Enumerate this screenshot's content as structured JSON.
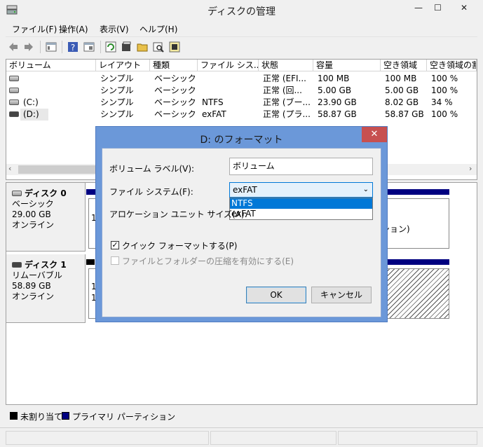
{
  "window": {
    "title": "ディスクの管理",
    "minimize_glyph": "—",
    "maximize_glyph": "☐",
    "close_glyph": "✕"
  },
  "menu": {
    "items": [
      "ファイル(F)",
      "操作(A)",
      "表示(V)",
      "ヘルプ(H)"
    ]
  },
  "toolbar": {
    "icons": [
      "back-arrow-icon",
      "forward-arrow-icon",
      "console-tree-icon",
      "help-icon",
      "properties-view-icon",
      "refresh-icon",
      "properties-icon",
      "open-folder-icon",
      "explore-icon",
      "settings-icon"
    ]
  },
  "volume_table": {
    "headers": [
      "ボリューム",
      "レイアウト",
      "種類",
      "ファイル シス...",
      "状態",
      "容量",
      "空き領域",
      "空き領域の割"
    ],
    "rows": [
      {
        "volume": "",
        "layout": "シンプル",
        "type": "ベーシック",
        "fs": "",
        "status": "正常 (EFI...",
        "capacity": "100 MB",
        "free": "100 MB",
        "pct": "100 %"
      },
      {
        "volume": "",
        "layout": "シンプル",
        "type": "ベーシック",
        "fs": "",
        "status": "正常 (回...",
        "capacity": "5.00 GB",
        "free": "5.00 GB",
        "pct": "100 %"
      },
      {
        "volume": "(C:)",
        "layout": "シンプル",
        "type": "ベーシック",
        "fs": "NTFS",
        "status": "正常 (ブー...",
        "capacity": "23.90 GB",
        "free": "8.02 GB",
        "pct": "34 %"
      },
      {
        "volume": "(D:)",
        "layout": "シンプル",
        "type": "ベーシック",
        "fs": "exFAT",
        "status": "正常 (プラ...",
        "capacity": "58.87 GB",
        "free": "58.87 GB",
        "pct": "100 %"
      }
    ]
  },
  "disks": [
    {
      "name": "ディスク 0",
      "kind": "ベーシック",
      "size": "29.00 GB",
      "state": "オンライン",
      "partial_text_left": "1",
      "partial_text_right": "ション)"
    },
    {
      "name": "ディスク 1",
      "kind": "リムーバブル",
      "size": "58.89 GB",
      "state": "オンライン",
      "partial_text_left": "1",
      "partial_text_left2": "1"
    }
  ],
  "legend": {
    "unallocated": "未割り当て",
    "primary": "プライマリ パーティション",
    "unallocated_color": "#000000",
    "primary_color": "#000080"
  },
  "dialog": {
    "title": "D: のフォーマット",
    "close_glyph": "✕",
    "volume_label_label": "ボリューム ラベル(V):",
    "volume_label_value": "ボリューム",
    "filesystem_label": "ファイル システム(F):",
    "filesystem_value": "exFAT",
    "filesystem_options": [
      "NTFS",
      "exFAT"
    ],
    "filesystem_highlighted": "NTFS",
    "allocation_label": "アロケーション ユニット サイズ(A):",
    "quick_format_label": "クイック フォーマットする(P)",
    "quick_format_checked": true,
    "compression_label": "ファイルとフォルダーの圧縮を有効にする(E)",
    "compression_checked": false,
    "ok_label": "OK",
    "cancel_label": "キャンセル"
  }
}
